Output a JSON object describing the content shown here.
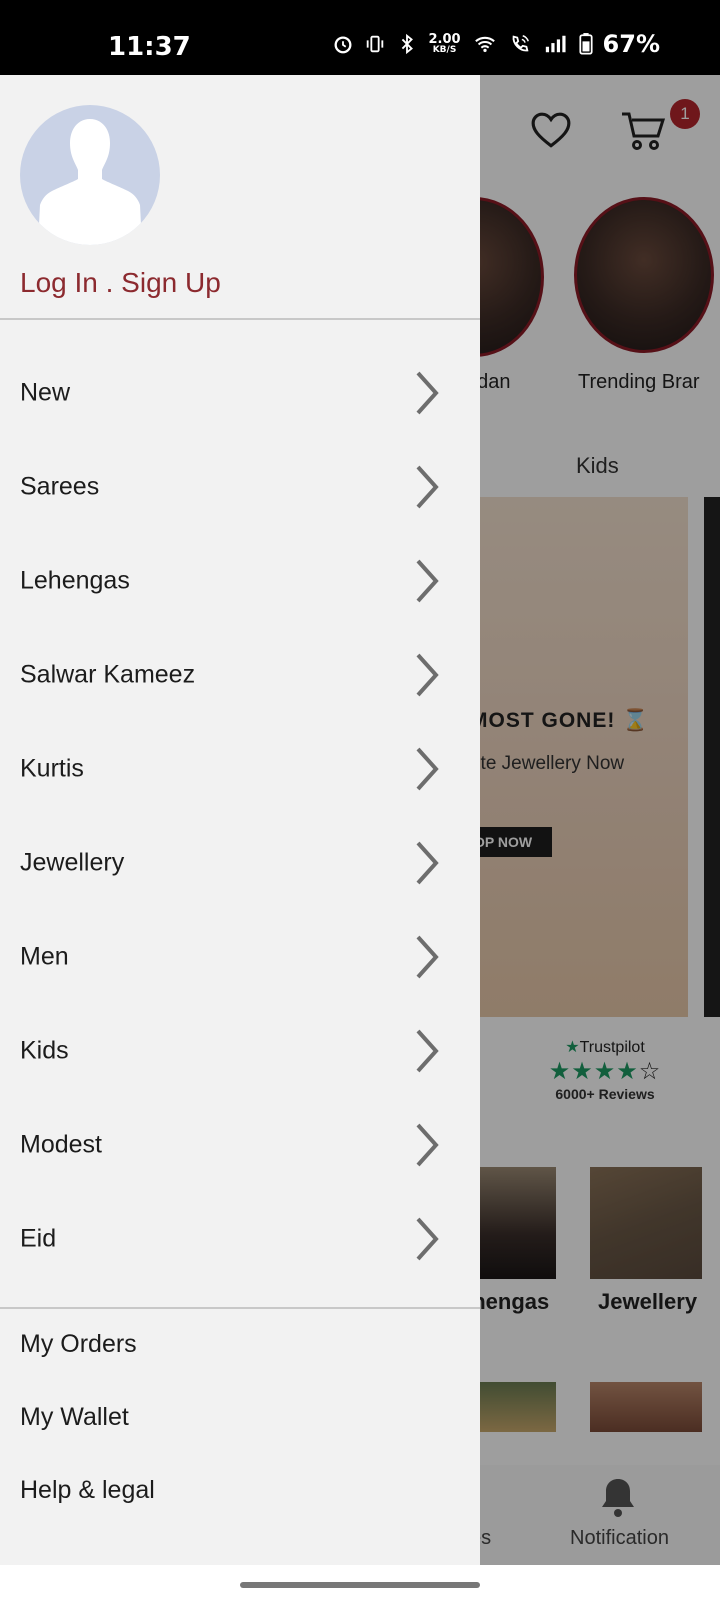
{
  "status_bar": {
    "time": "11:37",
    "net_speed_value": "2.00",
    "net_speed_unit": "KB/S",
    "battery": "67%"
  },
  "background": {
    "cart_count": "1",
    "stories": [
      "adan",
      "Trending Brar"
    ],
    "tab_visible": "Kids",
    "banner": {
      "headline": "MOST GONE!",
      "subline": "rite Jewellery Now",
      "button": "OP NOW"
    },
    "trustpilot": {
      "logo": "Trustpilot",
      "reviews": "6000+ Reviews"
    },
    "categories": [
      "ehengas",
      "Jewellery"
    ],
    "bottom_nav": {
      "partial_label": "es",
      "notification_label": "Notification"
    }
  },
  "drawer": {
    "auth_link": "Log In . Sign Up",
    "menu": [
      {
        "label": "New"
      },
      {
        "label": "Sarees"
      },
      {
        "label": "Lehengas"
      },
      {
        "label": "Salwar Kameez"
      },
      {
        "label": "Kurtis"
      },
      {
        "label": "Jewellery"
      },
      {
        "label": "Men"
      },
      {
        "label": "Kids"
      },
      {
        "label": "Modest"
      },
      {
        "label": "Eid"
      }
    ],
    "links": [
      {
        "label": "My Orders"
      },
      {
        "label": "My Wallet"
      },
      {
        "label": "Help & legal"
      }
    ]
  },
  "colors": {
    "brand": "#8c2a2f",
    "drawer_bg": "#f2f2f2",
    "badge": "#b3262d"
  }
}
